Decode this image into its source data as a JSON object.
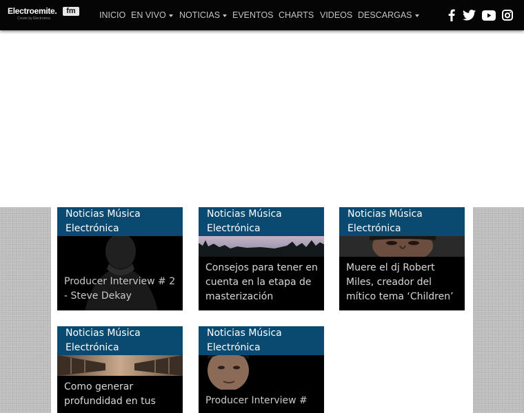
{
  "site": {
    "logo_text": "Electroemite.",
    "logo_badge": "fm",
    "logo_tagline": "Create by Electronica"
  },
  "nav": {
    "items": [
      {
        "label": "INICIO"
      },
      {
        "label": "EN VIVO"
      },
      {
        "label": "NOTICIAS"
      },
      {
        "label": "EVENTOS"
      },
      {
        "label": "CHARTS"
      },
      {
        "label": "VIDEOS"
      },
      {
        "label": "DESCARGAS"
      }
    ],
    "social_icons": [
      "facebook-icon",
      "twitter-icon",
      "youtube-icon",
      "instagram-icon"
    ]
  },
  "cards": [
    {
      "category": "Noticias Música Electrónica",
      "title": "Producer Interview # 2 - Steve Dekay",
      "image": "person-portrait-dark"
    },
    {
      "category": "Noticias Música Electrónica",
      "title": "Consejos para tener en cuenta en la etapa de masterización",
      "image": "forest-sky-landscape"
    },
    {
      "category": "Noticias Música Electrónica",
      "title": "Muere el dj Robert Miles, creador del mítico tema ‘Children’",
      "image": "face-close-up"
    },
    {
      "category": "Noticias Música Electrónica",
      "title": "Como generar profundidad en tus",
      "image": "abstract-tunnel"
    },
    {
      "category": "Noticias Música Electrónica",
      "title": "Producer Interview #",
      "image": "face-portrait-shadow"
    }
  ],
  "colors": {
    "navbar_bg": "#050505",
    "card_header_bg": "#0b4a70",
    "card_bg": "#000000",
    "page_side_bg": "#bcbcbc"
  }
}
